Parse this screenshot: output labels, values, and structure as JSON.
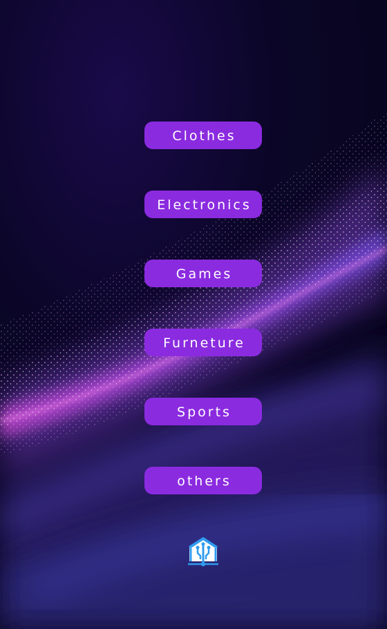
{
  "categories": [
    {
      "label": "Clothes"
    },
    {
      "label": "Electronics"
    },
    {
      "label": "Games"
    },
    {
      "label": "Furneture"
    },
    {
      "label": "Sports"
    },
    {
      "label": "others"
    }
  ],
  "logo": {
    "icon": "smart-home-icon"
  },
  "colors": {
    "button": "#8b2be0",
    "button_text": "#ffffff",
    "logo": "#2f9cf0",
    "background": "#05031a"
  }
}
